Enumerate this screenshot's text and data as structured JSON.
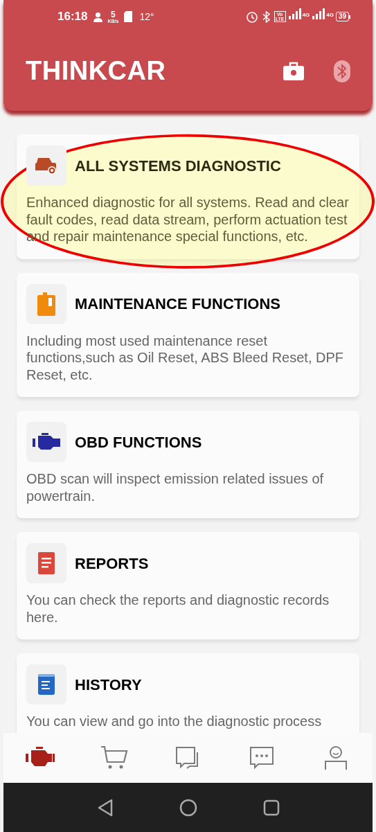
{
  "status_bar": {
    "time": "16:18",
    "speed_value": "5",
    "speed_unit": "KB/s",
    "temperature": "12°",
    "volte_top": "Vo",
    "volte_bottom": "LTE",
    "network_1": "4G",
    "network_2": "4G",
    "battery": "39"
  },
  "header": {
    "title": "THINKCAR"
  },
  "cards": [
    {
      "kind": "car",
      "title": "ALL SYSTEMS DIAGNOSTIC",
      "description": "Enhanced diagnostic for all systems. Read and clear fault codes, read data stream, perform actuation test and repair maintenance special functions, etc.",
      "highlighted": true
    },
    {
      "kind": "oil",
      "title": "MAINTENANCE FUNCTIONS",
      "description": "Including most used maintenance reset functions,such as Oil Reset, ABS Bleed Reset, DPF Reset, etc.",
      "highlighted": false
    },
    {
      "kind": "engine",
      "title": "OBD FUNCTIONS",
      "description": "OBD scan will inspect emission related issues of powertrain.",
      "highlighted": false
    },
    {
      "kind": "report",
      "title": "REPORTS",
      "description": "You can check the reports and diagnostic records here.",
      "highlighted": false
    },
    {
      "kind": "book",
      "title": "HISTORY",
      "description": "You can view and go into the diagnostic process",
      "highlighted": false
    }
  ],
  "bottom_nav": [
    {
      "kind": "engine",
      "selected": true
    },
    {
      "kind": "cart",
      "selected": false
    },
    {
      "kind": "chat",
      "selected": false
    },
    {
      "kind": "message",
      "selected": false
    },
    {
      "kind": "profile",
      "selected": false
    }
  ]
}
